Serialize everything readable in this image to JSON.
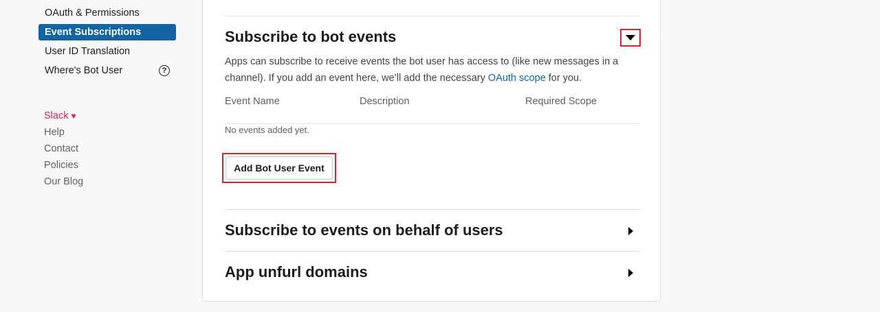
{
  "sidebar": {
    "items": [
      {
        "label": "OAuth & Permissions"
      },
      {
        "label": "Event Subscriptions"
      },
      {
        "label": "User ID Translation"
      },
      {
        "label": "Where's Bot User"
      }
    ],
    "links": [
      {
        "label": "Slack"
      },
      {
        "label": "Help"
      },
      {
        "label": "Contact"
      },
      {
        "label": "Policies"
      },
      {
        "label": "Our Blog"
      }
    ]
  },
  "bot_events": {
    "title": "Subscribe to bot events",
    "description_pre": "Apps can subscribe to receive events the bot user has access to (like new messages in a channel). If you add an event here, we’ll add the necessary ",
    "description_link": "OAuth scope",
    "description_post": " for you.",
    "columns": [
      "Event Name",
      "Description",
      "Required Scope"
    ],
    "empty_text": "No events added yet.",
    "add_button": "Add Bot User Event"
  },
  "user_events": {
    "title": "Subscribe to events on behalf of users"
  },
  "unfurl": {
    "title": "App unfurl domains"
  },
  "colors": {
    "accent": "#1264a3",
    "highlight": "#e0202b",
    "slack": "#e01e5a"
  }
}
